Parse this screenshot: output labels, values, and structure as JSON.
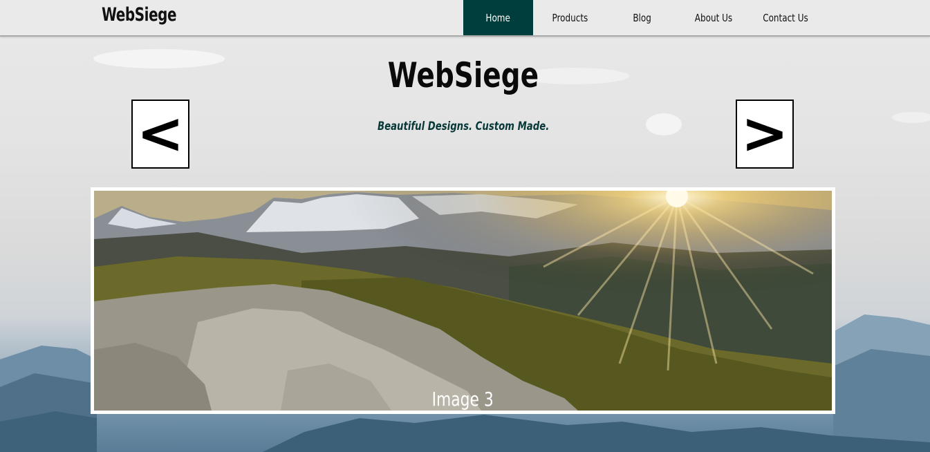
{
  "header": {
    "brand": "WebSiege",
    "menu": [
      {
        "label": "Home",
        "active": true
      },
      {
        "label": "Products",
        "active": false
      },
      {
        "label": "Blog",
        "active": false
      },
      {
        "label": "About Us",
        "active": false
      },
      {
        "label": "Contact Us",
        "active": false
      }
    ],
    "active_color": "#003d3d"
  },
  "hero": {
    "title": "WebSiege",
    "subtitle": "Beautiful Designs. Custom Made."
  },
  "slideshow": {
    "prev_label": "<",
    "next_label": ">",
    "caption": "Image 3"
  }
}
